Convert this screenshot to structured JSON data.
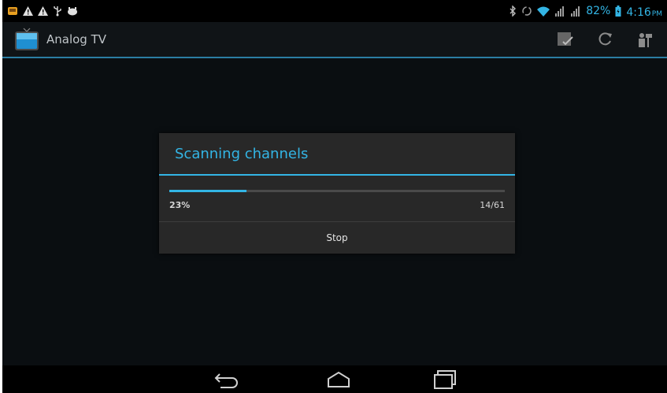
{
  "status_bar": {
    "left_icons": [
      "notification-app-icon",
      "warning-icon",
      "warning-icon",
      "usb-icon",
      "android-debug-icon"
    ],
    "right_icons": [
      "bluetooth-icon",
      "sync-icon",
      "wifi-icon",
      "signal-icon",
      "signal-icon",
      "battery-icon"
    ],
    "battery_percent": "82%",
    "time": "4:16",
    "ampm": "PM"
  },
  "action_bar": {
    "title": "Analog TV",
    "icon": "tv-icon",
    "actions": [
      "edit-check-icon",
      "refresh-icon",
      "settings-person-icon"
    ]
  },
  "dialog": {
    "title": "Scanning channels",
    "progress_fraction": 0.23,
    "progress_percent_label": "23%",
    "progress_count_label": "14/61",
    "stop_label": "Stop"
  },
  "nav_bar": {
    "buttons": [
      "back-icon",
      "home-icon",
      "recents-icon"
    ]
  },
  "colors": {
    "accent": "#33b5e5",
    "dialog_bg": "#282828",
    "background": "#0a0e11"
  }
}
